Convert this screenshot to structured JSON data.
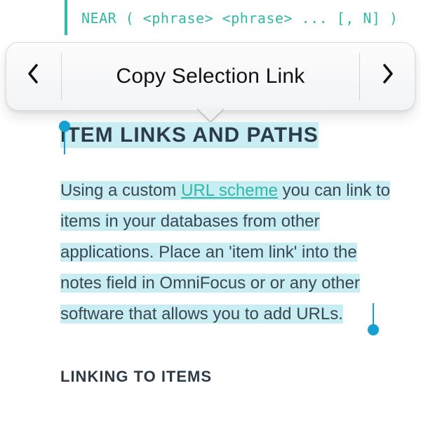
{
  "code": {
    "line": "NEAR ( <phrase> <phrase> ... [, N] )"
  },
  "popover": {
    "action_label": "Copy Selection Link"
  },
  "section": {
    "heading": "ITEM LINKS AND PATHS",
    "paragraph_seg1": "Using a custom ",
    "paragraph_link_text": "URL scheme",
    "paragraph_seg2": " you can link to items in your databases from other applications. Place an 'item link' into the notes field in OmniFocus or or any other software that allows you to add URLs."
  },
  "subheading": "LINKING TO ITEMS",
  "colors": {
    "accent": "#2fb9a6",
    "highlight": "#c8eef3",
    "selection_handle": "#169fd1"
  }
}
